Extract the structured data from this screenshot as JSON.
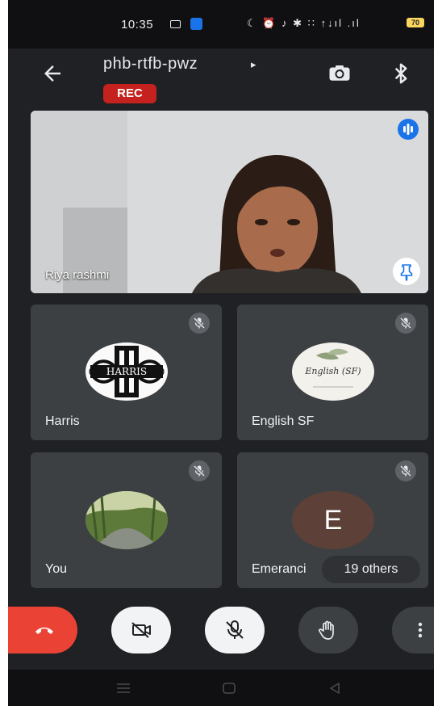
{
  "status_bar": {
    "time": "10:35",
    "right_icons": "☾ ⏰ ♪ ✱ ∷ ↑↓ıl .ıl",
    "battery": "70"
  },
  "header": {
    "meeting_code": "phb-rtfb-pwz",
    "caret": "▸",
    "recording_badge": "REC"
  },
  "main_tile": {
    "name": "Riya rashmi"
  },
  "tiles": [
    {
      "name": "Harris",
      "avatar_text": "HARRIS",
      "muted": true
    },
    {
      "name": "English SF",
      "avatar_text": "English (SF)",
      "muted": true
    },
    {
      "name": "You",
      "muted": true
    },
    {
      "name": "Emeranci",
      "avatar_letter": "E",
      "muted": true
    }
  ],
  "others_badge": "19 others",
  "colors": {
    "background": "#202124",
    "tile": "#3c4043",
    "end_call": "#ea4335",
    "rec": "#c5221f",
    "accent": "#1a73e8"
  },
  "icons": [
    "back-arrow-icon",
    "switch-camera-icon",
    "bluetooth-icon",
    "speaker-activity-icon",
    "pin-icon",
    "mic-off-icon",
    "end-call-icon",
    "camera-off-icon",
    "raise-hand-icon",
    "more-vert-icon"
  ]
}
